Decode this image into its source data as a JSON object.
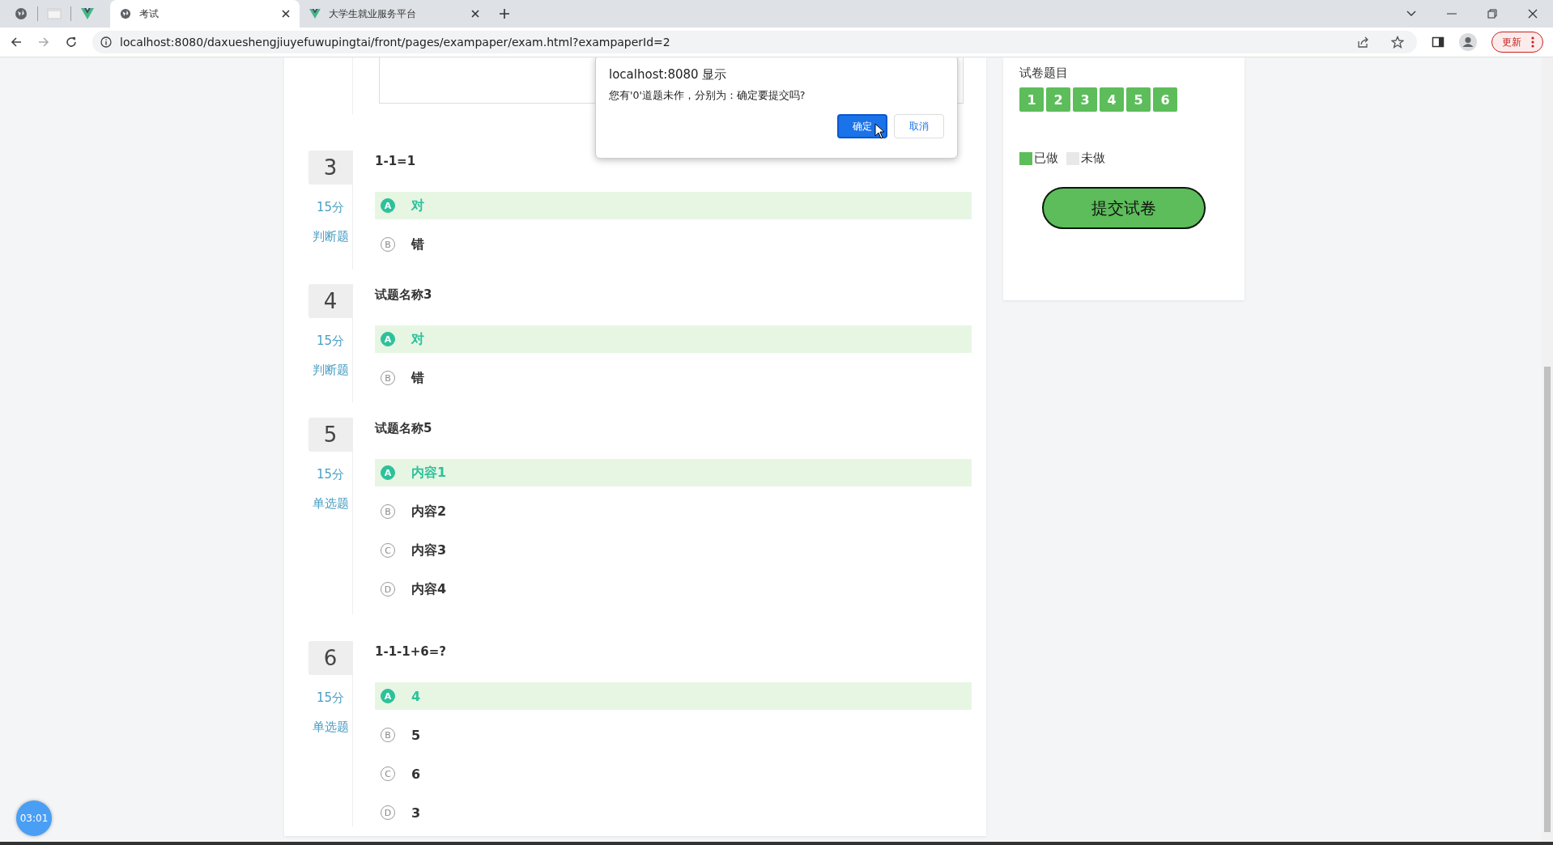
{
  "browser": {
    "tabs": [
      {
        "label": "考试",
        "selected": true,
        "kind": "globe"
      },
      {
        "label": "大学生就业服务平台",
        "selected": false,
        "kind": "vue"
      }
    ],
    "url": "localhost:8080/daxueshengjiuyefuwupingtai/front/pages/exampaper/exam.html?exampaperId=2",
    "update_button": "更新"
  },
  "dialog": {
    "title": "localhost:8080 显示",
    "message": "您有'0'道题未作，分别为：确定要提交吗?",
    "buttons": [
      {
        "label": "确定",
        "kind": "primary"
      },
      {
        "label": "取消",
        "kind": "secondary"
      }
    ]
  },
  "questions": [
    {
      "number": "3",
      "score": "15分",
      "type": "判断题",
      "title": "1-1=1",
      "options": [
        {
          "letter": "A",
          "text": "对",
          "selected": true
        },
        {
          "letter": "B",
          "text": "错",
          "selected": false
        }
      ]
    },
    {
      "number": "4",
      "score": "15分",
      "type": "判断题",
      "title": "试题名称3",
      "options": [
        {
          "letter": "A",
          "text": "对",
          "selected": true
        },
        {
          "letter": "B",
          "text": "错",
          "selected": false
        }
      ]
    },
    {
      "number": "5",
      "score": "15分",
      "type": "单选题",
      "title": "试题名称5",
      "options": [
        {
          "letter": "A",
          "text": "内容1",
          "selected": true
        },
        {
          "letter": "B",
          "text": "内容2",
          "selected": false
        },
        {
          "letter": "C",
          "text": "内容3",
          "selected": false
        },
        {
          "letter": "D",
          "text": "内容4",
          "selected": false
        }
      ]
    },
    {
      "number": "6",
      "score": "15分",
      "type": "单选题",
      "title": "1-1-1+6=?",
      "options": [
        {
          "letter": "A",
          "text": "4",
          "selected": true
        },
        {
          "letter": "B",
          "text": "5",
          "selected": false
        },
        {
          "letter": "C",
          "text": "6",
          "selected": false
        },
        {
          "letter": "D",
          "text": "3",
          "selected": false
        }
      ]
    }
  ],
  "sidebar": {
    "title": "试卷题目",
    "numbers": [
      {
        "label": "1",
        "done": true
      },
      {
        "label": "2",
        "done": true
      },
      {
        "label": "3",
        "done": true
      },
      {
        "label": "4",
        "done": true
      },
      {
        "label": "5",
        "done": true
      },
      {
        "label": "6",
        "done": true
      }
    ],
    "legend": [
      {
        "label": "已做",
        "kind": "done"
      },
      {
        "label": "未做",
        "kind": "todo"
      }
    ],
    "submit": "提交试卷"
  },
  "timer": "03:01"
}
